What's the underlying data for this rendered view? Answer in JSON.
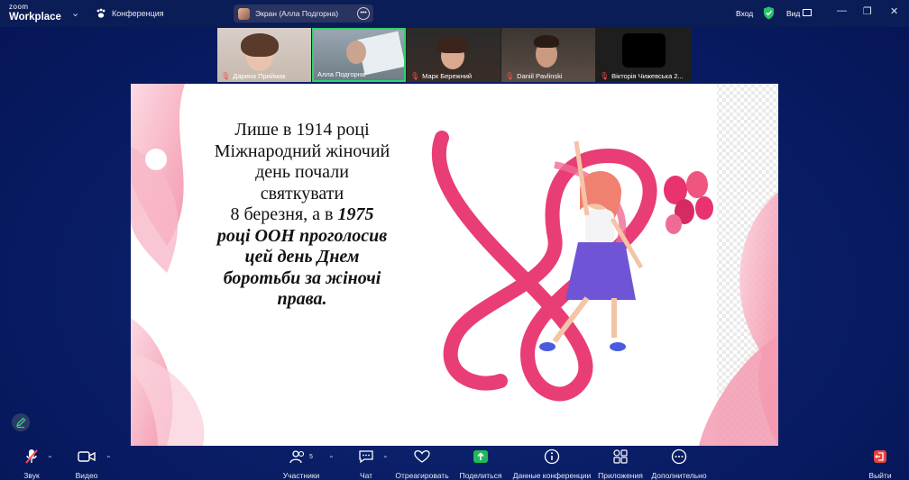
{
  "app": {
    "brand_small": "zoom",
    "brand_big": "Workplace"
  },
  "titlebar": {
    "conference_label": "Конференция",
    "screen_share_label": "Экран (Алла Подгорна)",
    "sign_in_label": "Вход",
    "view_label": "Вид"
  },
  "participants": [
    {
      "name": "Дарина Приймак",
      "muted": true
    },
    {
      "name": "Алла Подгорна",
      "muted": false,
      "active_speaker": true
    },
    {
      "name": "Марк Бережний",
      "muted": true
    },
    {
      "name": "Daniil Pavlinski",
      "muted": true
    },
    {
      "name": "Вікторія Чижевська 2...",
      "muted": true
    }
  ],
  "slide": {
    "lines_regular": [
      "Лише в 1914 році",
      "Міжнародний жіночий",
      "день почали",
      "святкувати"
    ],
    "line_mixed_prefix": " 8 березня, а в ",
    "line_mixed_bold": "1975",
    "lines_bold": [
      "році ООН проголосив",
      "цей день Днем",
      "боротьби за жіночі",
      "права."
    ]
  },
  "toolbar": {
    "audio_label": "Звук",
    "video_label": "Видео",
    "participants_label": "Участники",
    "participants_count": "5",
    "chat_label": "Чат",
    "react_label": "Отреагировать",
    "share_label": "Поделиться",
    "info_label": "Данные конференции",
    "apps_label": "Приложения",
    "more_label": "Дополнительно",
    "leave_label": "Выйти"
  },
  "colors": {
    "accent_green": "#2fd36b",
    "leave_red": "#e8413c",
    "mute_red": "#ff4d4d",
    "share_green": "#1fb85b",
    "slide_pink": "#e8336e"
  }
}
